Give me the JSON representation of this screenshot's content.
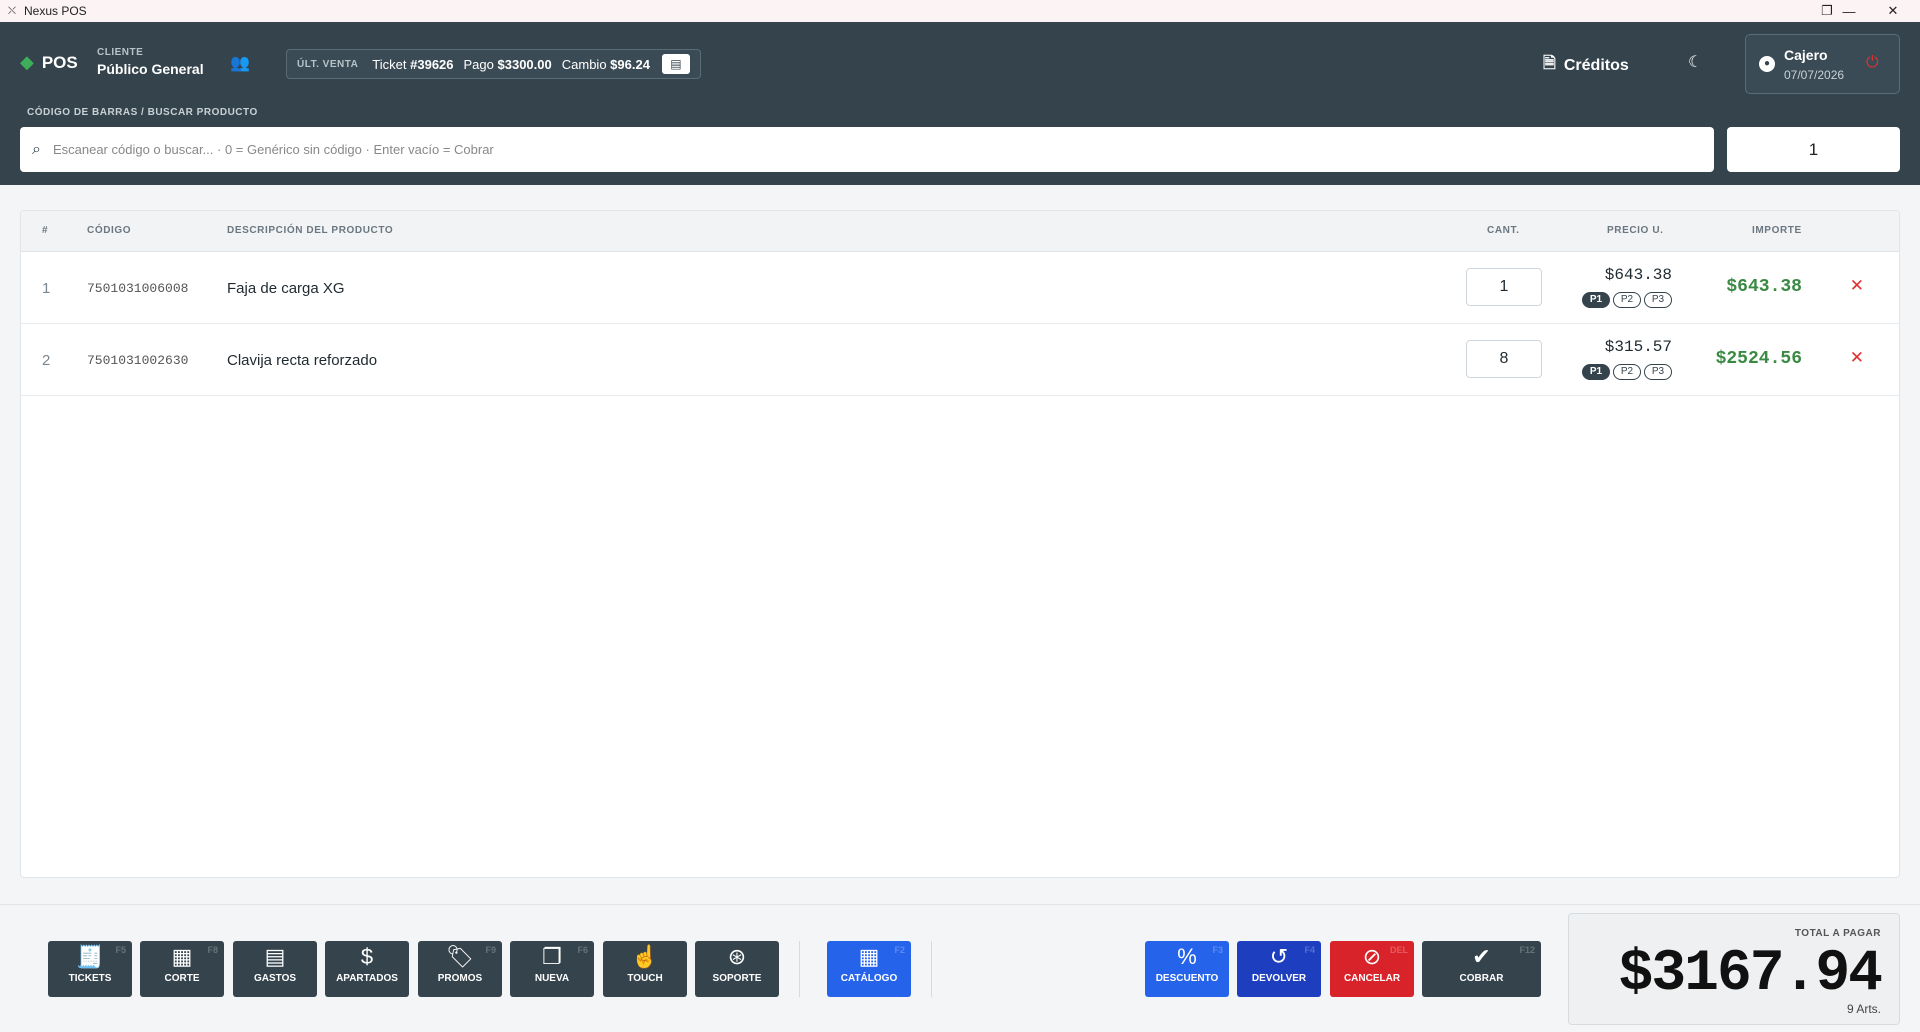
{
  "window": {
    "title": "Nexus POS",
    "app_icon": "pos-app-icon",
    "controls": [
      "minimize",
      "restore",
      "close"
    ]
  },
  "header": {
    "brand": "POS",
    "client": {
      "label": "CLIENTE",
      "value": "Público General"
    },
    "last_sale": {
      "label": "ÚLT. VENTA",
      "ticket_label": "Ticket",
      "ticket_value": "#39626",
      "payment_label": "Pago",
      "payment_value": "$3300.00",
      "change_label": "Cambio",
      "change_value": "$96.24"
    },
    "credits_label": "Créditos",
    "cashier": {
      "name": "Cajero",
      "date": "07/07/2026"
    }
  },
  "search": {
    "label": "CÓDIGO DE BARRAS / BUSCAR PRODUCTO",
    "placeholder": "Escanear código o buscar... · 0 = Genérico sin código · Enter vacío = Cobrar",
    "quantity": "1"
  },
  "table": {
    "headers": {
      "num": "#",
      "code": "CÓDIGO",
      "desc": "DESCRIPCIÓN DEL PRODUCTO",
      "qty": "CANT.",
      "price": "PRECIO U.",
      "amount": "IMPORTE"
    },
    "price_tiers": [
      "P1",
      "P2",
      "P3"
    ],
    "rows": [
      {
        "num": "1",
        "code": "7501031006008",
        "desc": "Faja de carga XG",
        "qty": "1",
        "price": "$643.38",
        "tier": "P1",
        "amount": "$643.38"
      },
      {
        "num": "2",
        "code": "7501031002630",
        "desc": "Clavija recta reforzado",
        "qty": "8",
        "price": "$315.57",
        "tier": "P1",
        "amount": "$2524.56"
      }
    ]
  },
  "footer": {
    "left_buttons": [
      {
        "label": "TICKETS",
        "key": "F5",
        "icon": "receipt-icon"
      },
      {
        "label": "CORTE",
        "key": "F8",
        "icon": "cash-register-icon"
      },
      {
        "label": "GASTOS",
        "key": "",
        "icon": "expense-receipt-icon"
      },
      {
        "label": "APARTADOS",
        "key": "",
        "icon": "hand-dollar-icon"
      },
      {
        "label": "PROMOS",
        "key": "F9",
        "icon": "tags-icon"
      },
      {
        "label": "NUEVA",
        "key": "F6",
        "icon": "new-window-icon"
      },
      {
        "label": "TOUCH",
        "key": "",
        "icon": "touch-icon"
      },
      {
        "label": "SOPORTE",
        "key": "",
        "icon": "lifebuoy-icon"
      }
    ],
    "catalog_button": {
      "label": "CATÁLOGO",
      "key": "F2",
      "icon": "boxes-icon"
    },
    "right_buttons": [
      {
        "label": "DESCUENTO",
        "key": "F3",
        "icon": "percent-icon"
      },
      {
        "label": "DEVOLVER",
        "key": "F4",
        "icon": "undo-icon"
      },
      {
        "label": "CANCELAR",
        "key": "DEL",
        "icon": "ban-icon"
      },
      {
        "label": "COBRAR",
        "key": "F12",
        "icon": "double-check-icon"
      }
    ],
    "total": {
      "label": "TOTAL A PAGAR",
      "value": "$3167.94",
      "articles": "9 Arts."
    }
  },
  "colors": {
    "header_bg": "#34434c",
    "accent_green": "#3a8a44",
    "blue": "#2563eb",
    "navy": "#1d3fbf",
    "red": "#d9232a",
    "danger_icon": "#e03131"
  }
}
